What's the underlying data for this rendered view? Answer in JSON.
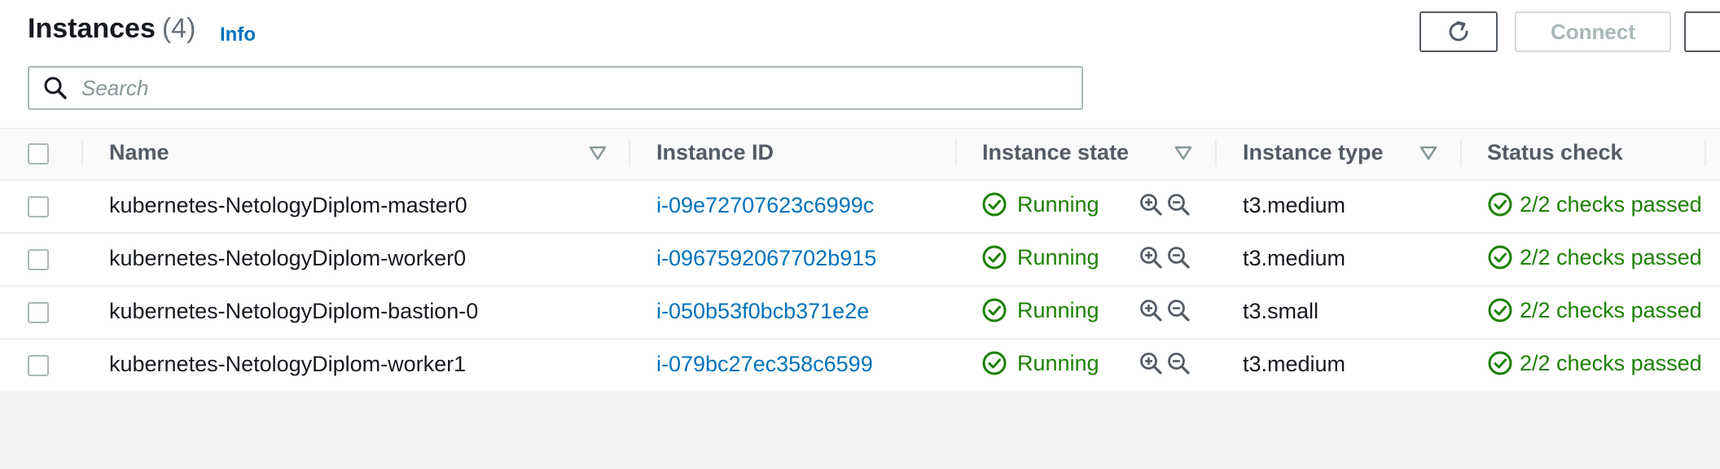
{
  "header": {
    "title": "Instances",
    "count": "(4)",
    "info_link": "Info",
    "connect_label": "Connect"
  },
  "search": {
    "placeholder": "Search"
  },
  "table": {
    "columns": [
      "Name",
      "Instance ID",
      "Instance state",
      "Instance type",
      "Status check"
    ],
    "rows": [
      {
        "name": "kubernetes-NetologyDiplom-master0",
        "instance_id": "i-09e72707623c6999c",
        "state": "Running",
        "type": "t3.medium",
        "status_check": "2/2 checks passed"
      },
      {
        "name": "kubernetes-NetologyDiplom-worker0",
        "instance_id": "i-0967592067702b915",
        "state": "Running",
        "type": "t3.medium",
        "status_check": "2/2 checks passed"
      },
      {
        "name": "kubernetes-NetologyDiplom-bastion-0",
        "instance_id": "i-050b53f0bcb371e2e",
        "state": "Running",
        "type": "t3.small",
        "status_check": "2/2 checks passed"
      },
      {
        "name": "kubernetes-NetologyDiplom-worker1",
        "instance_id": "i-079bc27ec358c6599",
        "state": "Running",
        "type": "t3.medium",
        "status_check": "2/2 checks passed"
      }
    ]
  },
  "icons": {
    "refresh": "refresh-icon",
    "search": "search-icon",
    "sort": "sort-caret-icon",
    "status_ok": "check-circle-icon",
    "zoom_in": "zoom-in-icon",
    "zoom_out": "zoom-out-icon"
  },
  "colors": {
    "link": "#0073bb",
    "success": "#1d8102",
    "header_text": "#545b64",
    "disabled": "#aab7b8"
  }
}
